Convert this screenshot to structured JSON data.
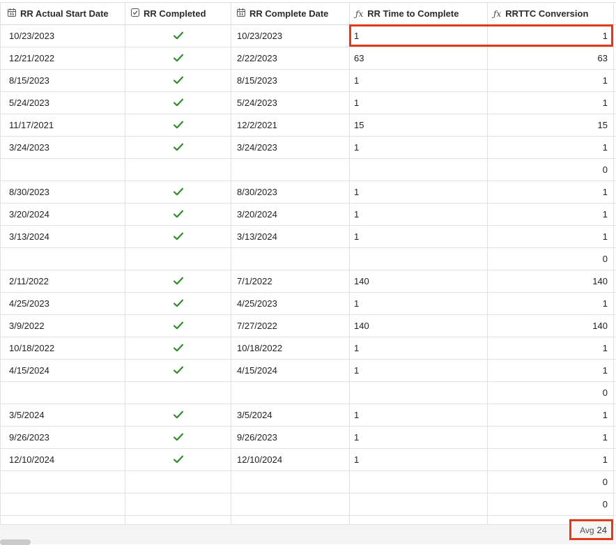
{
  "columns": [
    {
      "label": "RR Actual Start Date",
      "icon": "calendar-icon"
    },
    {
      "label": "RR Completed",
      "icon": "checkbox-icon"
    },
    {
      "label": "RR Complete Date",
      "icon": "calendar-icon"
    },
    {
      "label": "RR Time to Complete",
      "icon": "formula-icon"
    },
    {
      "label": "RRTTC Conversion",
      "icon": "formula-icon"
    }
  ],
  "fx_glyph": "ƒx",
  "check_color": "#2e8b2e",
  "highlight_color": "#e03a1c",
  "rows": [
    {
      "start": "10/23/2023",
      "done": true,
      "complete": "10/23/2023",
      "ttc": "1",
      "conv": "1"
    },
    {
      "start": "12/21/2022",
      "done": true,
      "complete": "2/22/2023",
      "ttc": "63",
      "conv": "63"
    },
    {
      "start": "8/15/2023",
      "done": true,
      "complete": "8/15/2023",
      "ttc": "1",
      "conv": "1"
    },
    {
      "start": "5/24/2023",
      "done": true,
      "complete": "5/24/2023",
      "ttc": "1",
      "conv": "1"
    },
    {
      "start": "11/17/2021",
      "done": true,
      "complete": "12/2/2021",
      "ttc": "15",
      "conv": "15"
    },
    {
      "start": "3/24/2023",
      "done": true,
      "complete": "3/24/2023",
      "ttc": "1",
      "conv": "1"
    },
    {
      "start": "",
      "done": false,
      "complete": "",
      "ttc": "",
      "conv": "0"
    },
    {
      "start": "8/30/2023",
      "done": true,
      "complete": "8/30/2023",
      "ttc": "1",
      "conv": "1"
    },
    {
      "start": "3/20/2024",
      "done": true,
      "complete": "3/20/2024",
      "ttc": "1",
      "conv": "1"
    },
    {
      "start": "3/13/2024",
      "done": true,
      "complete": "3/13/2024",
      "ttc": "1",
      "conv": "1"
    },
    {
      "start": "",
      "done": false,
      "complete": "",
      "ttc": "",
      "conv": "0"
    },
    {
      "start": "2/11/2022",
      "done": true,
      "complete": "7/1/2022",
      "ttc": "140",
      "conv": "140"
    },
    {
      "start": "4/25/2023",
      "done": true,
      "complete": "4/25/2023",
      "ttc": "1",
      "conv": "1"
    },
    {
      "start": "3/9/2022",
      "done": true,
      "complete": "7/27/2022",
      "ttc": "140",
      "conv": "140"
    },
    {
      "start": "10/18/2022",
      "done": true,
      "complete": "10/18/2022",
      "ttc": "1",
      "conv": "1"
    },
    {
      "start": "4/15/2024",
      "done": true,
      "complete": "4/15/2024",
      "ttc": "1",
      "conv": "1"
    },
    {
      "start": "",
      "done": false,
      "complete": "",
      "ttc": "",
      "conv": "0"
    },
    {
      "start": "3/5/2024",
      "done": true,
      "complete": "3/5/2024",
      "ttc": "1",
      "conv": "1"
    },
    {
      "start": "9/26/2023",
      "done": true,
      "complete": "9/26/2023",
      "ttc": "1",
      "conv": "1"
    },
    {
      "start": "12/10/2024",
      "done": true,
      "complete": "12/10/2024",
      "ttc": "1",
      "conv": "1"
    },
    {
      "start": "",
      "done": false,
      "complete": "",
      "ttc": "",
      "conv": "0"
    },
    {
      "start": "",
      "done": false,
      "complete": "",
      "ttc": "",
      "conv": "0"
    }
  ],
  "summary": {
    "label": "Avg",
    "value": "24"
  }
}
